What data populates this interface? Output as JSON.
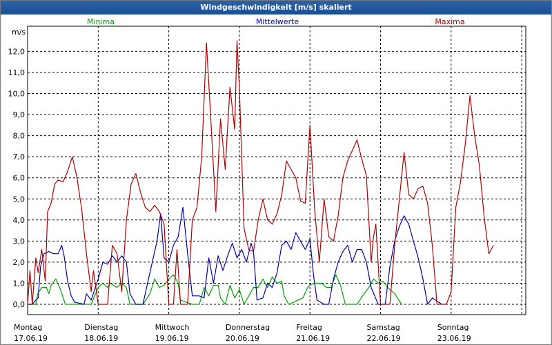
{
  "window_title": "Windgeschwindigkeit [m/s] skaliert",
  "chart_data": {
    "type": "line",
    "title": "Windgeschwindigkeit [m/s] skaliert",
    "ylabel": "m/s",
    "ylim": [
      0,
      13
    ],
    "yticks": [
      "0,0",
      "1,0",
      "2,0",
      "3,0",
      "4,0",
      "5,0",
      "6,0",
      "7,0",
      "8,0",
      "9,0",
      "10,0",
      "11,0",
      "12,0"
    ],
    "x_days": [
      {
        "day": "Montag",
        "date": "17.06.19"
      },
      {
        "day": "Dienstag",
        "date": "18.06.19"
      },
      {
        "day": "Mittwoch",
        "date": "19.06.19"
      },
      {
        "day": "Donnerstag",
        "date": "20.06.19"
      },
      {
        "day": "Freitag",
        "date": "21.06.19"
      },
      {
        "day": "Samstag",
        "date": "22.06.19"
      },
      {
        "day": "Sonntag",
        "date": "23.06.19"
      }
    ],
    "grid": true,
    "legend_position": "top",
    "series": [
      {
        "name": "Minima",
        "color": "#00a000",
        "points": [
          [
            0.0,
            0
          ],
          [
            0.35,
            0
          ],
          [
            0.43,
            0.5
          ],
          [
            0.6,
            0.8
          ],
          [
            0.8,
            0.8
          ],
          [
            0.9,
            0.5
          ],
          [
            1.0,
            0.9
          ],
          [
            1.2,
            1.2
          ],
          [
            1.4,
            0.7
          ],
          [
            1.6,
            0
          ],
          [
            2.0,
            0
          ],
          [
            2.7,
            0
          ],
          [
            3.0,
            0.8
          ],
          [
            3.2,
            1.0
          ],
          [
            3.4,
            0.8
          ],
          [
            3.5,
            1.0
          ],
          [
            3.8,
            0.8
          ],
          [
            4.0,
            1.0
          ],
          [
            4.2,
            0.8
          ],
          [
            4.35,
            0
          ],
          [
            4.6,
            0
          ],
          [
            4.9,
            0
          ],
          [
            5.2,
            0.5
          ],
          [
            5.4,
            1.2
          ],
          [
            5.6,
            0.8
          ],
          [
            5.8,
            0.9
          ],
          [
            6.0,
            1.2
          ],
          [
            6.2,
            1.4
          ],
          [
            6.4,
            1.0
          ],
          [
            6.5,
            0.2
          ],
          [
            7.0,
            0
          ],
          [
            7.3,
            0
          ],
          [
            7.5,
            0.8
          ],
          [
            7.7,
            0.4
          ],
          [
            7.9,
            0.9
          ],
          [
            8.1,
            0.9
          ],
          [
            8.2,
            0.3
          ],
          [
            8.4,
            0
          ],
          [
            8.6,
            0.9
          ],
          [
            8.8,
            0.3
          ],
          [
            9.0,
            0.7
          ],
          [
            9.2,
            0
          ],
          [
            9.6,
            0.8
          ],
          [
            9.8,
            0.8
          ],
          [
            10.0,
            1.2
          ],
          [
            10.2,
            0.8
          ],
          [
            10.4,
            1.3
          ],
          [
            10.6,
            1.0
          ],
          [
            10.8,
            1.1
          ],
          [
            10.9,
            0.4
          ],
          [
            11.1,
            0
          ],
          [
            11.7,
            0.3
          ],
          [
            11.9,
            0.8
          ],
          [
            12.0,
            0.9
          ],
          [
            12.2,
            1.0
          ],
          [
            12.5,
            1.0
          ],
          [
            12.7,
            0.8
          ],
          [
            12.9,
            0.8
          ],
          [
            13.1,
            1.4
          ],
          [
            13.3,
            0.9
          ],
          [
            13.5,
            0
          ],
          [
            14.0,
            0
          ],
          [
            14.3,
            0.5
          ],
          [
            14.5,
            0.8
          ],
          [
            14.7,
            1.2
          ],
          [
            14.9,
            1.0
          ],
          [
            15.1,
            1.1
          ],
          [
            15.3,
            0.8
          ],
          [
            15.6,
            0.5
          ],
          [
            15.9,
            0
          ]
        ]
      },
      {
        "name": "Mittelwerte",
        "color": "#0000b0",
        "points": [
          [
            0.0,
            0
          ],
          [
            0.2,
            0
          ],
          [
            0.35,
            0.2
          ],
          [
            0.45,
            0.3
          ],
          [
            0.55,
            1.8
          ],
          [
            0.7,
            2.4
          ],
          [
            0.9,
            2.5
          ],
          [
            1.1,
            2.4
          ],
          [
            1.3,
            2.4
          ],
          [
            1.45,
            2.8
          ],
          [
            1.55,
            2.3
          ],
          [
            1.7,
            1.1
          ],
          [
            1.85,
            0.4
          ],
          [
            2.0,
            0.1
          ],
          [
            2.4,
            0
          ],
          [
            2.5,
            0.5
          ],
          [
            2.7,
            0.2
          ],
          [
            3.0,
            1.2
          ],
          [
            3.2,
            2.0
          ],
          [
            3.4,
            1.9
          ],
          [
            3.6,
            2.3
          ],
          [
            3.8,
            2.0
          ],
          [
            4.0,
            2.3
          ],
          [
            4.2,
            2.0
          ],
          [
            4.35,
            0.5
          ],
          [
            4.6,
            0
          ],
          [
            4.9,
            0
          ],
          [
            5.1,
            1.0
          ],
          [
            5.3,
            2.0
          ],
          [
            5.5,
            3.0
          ],
          [
            5.65,
            4.3
          ],
          [
            5.8,
            2.2
          ],
          [
            6.0,
            2.0
          ],
          [
            6.2,
            2.8
          ],
          [
            6.4,
            3.2
          ],
          [
            6.6,
            4.6
          ],
          [
            6.8,
            2.4
          ],
          [
            7.0,
            0.4
          ],
          [
            7.3,
            0.4
          ],
          [
            7.5,
            0.3
          ],
          [
            7.7,
            2.2
          ],
          [
            7.9,
            1.0
          ],
          [
            8.1,
            2.3
          ],
          [
            8.3,
            1.6
          ],
          [
            8.5,
            2.3
          ],
          [
            8.7,
            2.9
          ],
          [
            8.9,
            2.2
          ],
          [
            9.1,
            2.6
          ],
          [
            9.3,
            2.0
          ],
          [
            9.5,
            2.9
          ],
          [
            9.6,
            2.5
          ],
          [
            9.75,
            0.2
          ],
          [
            10.0,
            0.3
          ],
          [
            10.2,
            1.0
          ],
          [
            10.4,
            0.8
          ],
          [
            10.6,
            1.5
          ],
          [
            10.8,
            2.8
          ],
          [
            11.0,
            3.0
          ],
          [
            11.2,
            2.6
          ],
          [
            11.4,
            3.4
          ],
          [
            11.6,
            3.0
          ],
          [
            11.8,
            2.6
          ],
          [
            12.0,
            3.1
          ],
          [
            12.15,
            1.4
          ],
          [
            12.3,
            0.2
          ],
          [
            12.6,
            0
          ],
          [
            12.8,
            0
          ],
          [
            13.0,
            1.2
          ],
          [
            13.2,
            2.0
          ],
          [
            13.4,
            2.5
          ],
          [
            13.6,
            2.8
          ],
          [
            13.8,
            2.0
          ],
          [
            14.0,
            2.6
          ],
          [
            14.2,
            2.6
          ],
          [
            14.4,
            2.0
          ],
          [
            14.6,
            0.8
          ],
          [
            14.9,
            0
          ],
          [
            15.2,
            0
          ],
          [
            15.4,
            1.8
          ],
          [
            15.6,
            3.0
          ],
          [
            15.8,
            3.7
          ],
          [
            16.0,
            4.2
          ],
          [
            16.2,
            3.8
          ],
          [
            16.4,
            3.0
          ],
          [
            16.6,
            2.2
          ],
          [
            16.8,
            1.2
          ],
          [
            17.0,
            0
          ],
          [
            17.2,
            0.3
          ],
          [
            17.6,
            0
          ]
        ]
      },
      {
        "name": "Maxima",
        "color": "#b00000",
        "points": [
          [
            0.0,
            0
          ],
          [
            0.1,
            1.6
          ],
          [
            0.2,
            0
          ],
          [
            0.35,
            2.2
          ],
          [
            0.45,
            1.5
          ],
          [
            0.6,
            2.6
          ],
          [
            0.75,
            1.1
          ],
          [
            0.85,
            4.4
          ],
          [
            1.0,
            4.8
          ],
          [
            1.15,
            5.7
          ],
          [
            1.3,
            5.9
          ],
          [
            1.5,
            5.8
          ],
          [
            1.7,
            6.3
          ],
          [
            1.9,
            7.0
          ],
          [
            2.1,
            6.0
          ],
          [
            2.3,
            4.5
          ],
          [
            2.5,
            2.4
          ],
          [
            2.7,
            0.6
          ],
          [
            2.8,
            1.6
          ],
          [
            3.0,
            0
          ],
          [
            3.2,
            0
          ],
          [
            3.4,
            0
          ],
          [
            3.6,
            2.8
          ],
          [
            3.8,
            2.4
          ],
          [
            4.0,
            0.6
          ],
          [
            4.2,
            4.0
          ],
          [
            4.4,
            5.7
          ],
          [
            4.6,
            6.2
          ],
          [
            4.8,
            5.3
          ],
          [
            5.0,
            4.6
          ],
          [
            5.2,
            4.4
          ],
          [
            5.4,
            4.7
          ],
          [
            5.6,
            4.4
          ],
          [
            5.8,
            3.8
          ],
          [
            6.0,
            0
          ],
          [
            6.2,
            0
          ],
          [
            6.35,
            2.6
          ],
          [
            6.5,
            0
          ],
          [
            6.8,
            0
          ],
          [
            7.0,
            4.0
          ],
          [
            7.2,
            4.6
          ],
          [
            7.4,
            7.0
          ],
          [
            7.6,
            12.4
          ],
          [
            7.8,
            8.5
          ],
          [
            8.0,
            4.4
          ],
          [
            8.2,
            8.8
          ],
          [
            8.4,
            6.4
          ],
          [
            8.6,
            10.3
          ],
          [
            8.8,
            8.3
          ],
          [
            8.9,
            12.5
          ],
          [
            9.0,
            10.3
          ],
          [
            9.2,
            3.6
          ],
          [
            9.4,
            2.6
          ],
          [
            9.6,
            2.5
          ],
          [
            9.8,
            4.0
          ],
          [
            10.0,
            5.0
          ],
          [
            10.2,
            4.0
          ],
          [
            10.4,
            3.8
          ],
          [
            10.6,
            4.3
          ],
          [
            10.8,
            5.2
          ],
          [
            11.0,
            6.8
          ],
          [
            11.2,
            6.4
          ],
          [
            11.4,
            6.0
          ],
          [
            11.6,
            4.9
          ],
          [
            11.8,
            4.8
          ],
          [
            12.0,
            8.5
          ],
          [
            12.2,
            4.5
          ],
          [
            12.4,
            2.0
          ],
          [
            12.6,
            5.0
          ],
          [
            12.8,
            3.2
          ],
          [
            13.0,
            3.0
          ],
          [
            13.2,
            4.2
          ],
          [
            13.4,
            6.0
          ],
          [
            13.6,
            6.8
          ],
          [
            13.8,
            7.3
          ],
          [
            14.0,
            7.8
          ],
          [
            14.2,
            6.9
          ],
          [
            14.4,
            6.1
          ],
          [
            14.6,
            2.0
          ],
          [
            14.7,
            3.2
          ],
          [
            14.8,
            3.8
          ],
          [
            15.0,
            0
          ],
          [
            15.4,
            0
          ],
          [
            15.6,
            2.8
          ],
          [
            15.8,
            5.0
          ],
          [
            16.0,
            7.2
          ],
          [
            16.2,
            5.2
          ],
          [
            16.4,
            5.0
          ],
          [
            16.6,
            5.5
          ],
          [
            16.8,
            5.6
          ],
          [
            17.0,
            4.8
          ],
          [
            17.2,
            2.8
          ],
          [
            17.4,
            0
          ],
          [
            17.8,
            0
          ],
          [
            18.0,
            0.6
          ],
          [
            18.2,
            4.6
          ],
          [
            18.4,
            5.8
          ],
          [
            18.6,
            7.6
          ],
          [
            18.8,
            9.9
          ],
          [
            19.0,
            8.0
          ],
          [
            19.2,
            6.6
          ],
          [
            19.4,
            4.2
          ],
          [
            19.6,
            2.4
          ],
          [
            19.8,
            2.8
          ]
        ]
      }
    ]
  }
}
